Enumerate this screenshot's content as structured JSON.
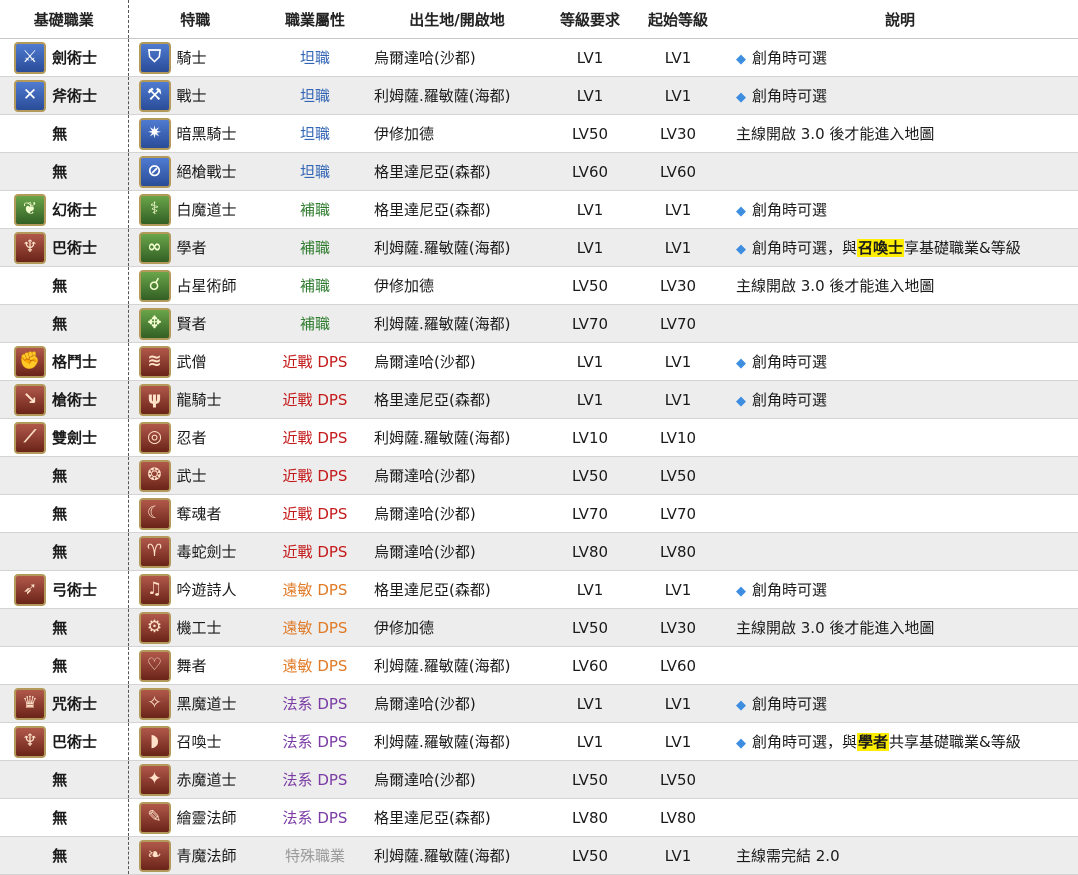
{
  "headers": {
    "base": "基礎職業",
    "job": "特職",
    "role": "職業屬性",
    "origin": "出生地/開啟地",
    "req": "等級要求",
    "start": "起始等級",
    "desc": "說明"
  },
  "colors": {
    "tank": "#3466b5",
    "healer": "#2f7d2f",
    "melee": "#c41a1a",
    "ranged": "#e07a26",
    "caster": "#7a3ba4",
    "special": "#9a9a9a",
    "highlight": "#ffee00"
  },
  "rows": [
    {
      "base": "劍術士",
      "base_icon": "sword-icon",
      "base_icon_glyph": "⚔",
      "base_color": "blue",
      "job": "騎士",
      "job_icon": "shield-icon",
      "job_icon_glyph": "⛉",
      "job_color": "blue",
      "role": "坦職",
      "role_class": "tank",
      "origin": "烏爾達哈(沙都)",
      "req": "LV1",
      "start": "LV1",
      "bullet": true,
      "desc": "創角時可選"
    },
    {
      "base": "斧術士",
      "base_icon": "axe-icon",
      "base_icon_glyph": "✕",
      "base_color": "blue",
      "job": "戰士",
      "job_icon": "warrior-icon",
      "job_icon_glyph": "⚒",
      "job_color": "blue",
      "role": "坦職",
      "role_class": "tank",
      "origin": "利姆薩.羅敏薩(海都)",
      "req": "LV1",
      "start": "LV1",
      "bullet": true,
      "desc": "創角時可選"
    },
    {
      "base": "無",
      "base_icon": "",
      "job": "暗黑騎士",
      "job_icon": "dark-knight-icon",
      "job_icon_glyph": "✷",
      "job_color": "blue",
      "role": "坦職",
      "role_class": "tank",
      "origin": "伊修加德",
      "req": "LV50",
      "start": "LV30",
      "bullet": false,
      "desc": "主線開啟 3.0 後才能進入地圖"
    },
    {
      "base": "無",
      "base_icon": "",
      "job": "絕槍戰士",
      "job_icon": "gunbreaker-icon",
      "job_icon_glyph": "⊘",
      "job_color": "blue",
      "role": "坦職",
      "role_class": "tank",
      "origin": "格里達尼亞(森都)",
      "req": "LV60",
      "start": "LV60",
      "bullet": false,
      "desc": ""
    },
    {
      "base": "幻術士",
      "base_icon": "conjurer-icon",
      "base_icon_glyph": "❦",
      "base_color": "green",
      "job": "白魔道士",
      "job_icon": "white-mage-icon",
      "job_icon_glyph": "⚕",
      "job_color": "green",
      "role": "補職",
      "role_class": "healer",
      "origin": "格里達尼亞(森都)",
      "req": "LV1",
      "start": "LV1",
      "bullet": true,
      "desc": "創角時可選"
    },
    {
      "base": "巴術士",
      "base_icon": "arcanist-icon",
      "base_icon_glyph": "♆",
      "base_color": "red",
      "job": "學者",
      "job_icon": "scholar-icon",
      "job_icon_glyph": "∞",
      "job_color": "green",
      "role": "補職",
      "role_class": "healer",
      "origin": "利姆薩.羅敏薩(海都)",
      "req": "LV1",
      "start": "LV1",
      "bullet": true,
      "desc": "創角時可選，與",
      "hl": "召喚士",
      "desc_after": "享基礎職業&等級"
    },
    {
      "base": "無",
      "base_icon": "",
      "job": "占星術師",
      "job_icon": "astrologian-icon",
      "job_icon_glyph": "☌",
      "job_color": "green",
      "role": "補職",
      "role_class": "healer",
      "origin": "伊修加德",
      "req": "LV50",
      "start": "LV30",
      "bullet": false,
      "desc": "主線開啟 3.0 後才能進入地圖"
    },
    {
      "base": "無",
      "base_icon": "",
      "job": "賢者",
      "job_icon": "sage-icon",
      "job_icon_glyph": "✥",
      "job_color": "green",
      "role": "補職",
      "role_class": "healer",
      "origin": "利姆薩.羅敏薩(海都)",
      "req": "LV70",
      "start": "LV70",
      "bullet": false,
      "desc": ""
    },
    {
      "base": "格鬥士",
      "base_icon": "pugilist-icon",
      "base_icon_glyph": "✊",
      "base_color": "red",
      "job": "武僧",
      "job_icon": "monk-icon",
      "job_icon_glyph": "≋",
      "job_color": "red",
      "role": "近戰 DPS",
      "role_class": "melee",
      "origin": "烏爾達哈(沙都)",
      "req": "LV1",
      "start": "LV1",
      "bullet": true,
      "desc": "創角時可選"
    },
    {
      "base": "槍術士",
      "base_icon": "lancer-icon",
      "base_icon_glyph": "↘",
      "base_color": "red",
      "job": "龍騎士",
      "job_icon": "dragoon-icon",
      "job_icon_glyph": "ψ",
      "job_color": "red",
      "role": "近戰 DPS",
      "role_class": "melee",
      "origin": "格里達尼亞(森都)",
      "req": "LV1",
      "start": "LV1",
      "bullet": true,
      "desc": "創角時可選"
    },
    {
      "base": "雙劍士",
      "base_icon": "rogue-icon",
      "base_icon_glyph": "⟋",
      "base_color": "red",
      "job": "忍者",
      "job_icon": "ninja-icon",
      "job_icon_glyph": "◎",
      "job_color": "red",
      "role": "近戰 DPS",
      "role_class": "melee",
      "origin": "利姆薩.羅敏薩(海都)",
      "req": "LV10",
      "start": "LV10",
      "bullet": false,
      "desc": ""
    },
    {
      "base": "無",
      "base_icon": "",
      "job": "武士",
      "job_icon": "samurai-icon",
      "job_icon_glyph": "❂",
      "job_color": "red",
      "role": "近戰 DPS",
      "role_class": "melee",
      "origin": "烏爾達哈(沙都)",
      "req": "LV50",
      "start": "LV50",
      "bullet": false,
      "desc": ""
    },
    {
      "base": "無",
      "base_icon": "",
      "job": "奪魂者",
      "job_icon": "reaper-icon",
      "job_icon_glyph": "☾",
      "job_color": "red",
      "role": "近戰 DPS",
      "role_class": "melee",
      "origin": "烏爾達哈(沙都)",
      "req": "LV70",
      "start": "LV70",
      "bullet": false,
      "desc": ""
    },
    {
      "base": "無",
      "base_icon": "",
      "job": "毒蛇劍士",
      "job_icon": "viper-icon",
      "job_icon_glyph": "♈",
      "job_color": "red",
      "role": "近戰 DPS",
      "role_class": "melee",
      "origin": "烏爾達哈(沙都)",
      "req": "LV80",
      "start": "LV80",
      "bullet": false,
      "desc": ""
    },
    {
      "base": "弓術士",
      "base_icon": "archer-icon",
      "base_icon_glyph": "➶",
      "base_color": "red",
      "job": "吟遊詩人",
      "job_icon": "bard-icon",
      "job_icon_glyph": "♫",
      "job_color": "red",
      "role": "遠敏 DPS",
      "role_class": "ranged",
      "origin": "格里達尼亞(森都)",
      "req": "LV1",
      "start": "LV1",
      "bullet": true,
      "desc": "創角時可選"
    },
    {
      "base": "無",
      "base_icon": "",
      "job": "機工士",
      "job_icon": "machinist-icon",
      "job_icon_glyph": "⚙",
      "job_color": "red",
      "role": "遠敏 DPS",
      "role_class": "ranged",
      "origin": "伊修加德",
      "req": "LV50",
      "start": "LV30",
      "bullet": false,
      "desc": "主線開啟 3.0 後才能進入地圖"
    },
    {
      "base": "無",
      "base_icon": "",
      "job": "舞者",
      "job_icon": "dancer-icon",
      "job_icon_glyph": "♡",
      "job_color": "red",
      "role": "遠敏 DPS",
      "role_class": "ranged",
      "origin": "利姆薩.羅敏薩(海都)",
      "req": "LV60",
      "start": "LV60",
      "bullet": false,
      "desc": ""
    },
    {
      "base": "咒術士",
      "base_icon": "thaumaturge-icon",
      "base_icon_glyph": "♛",
      "base_color": "red",
      "job": "黑魔道士",
      "job_icon": "black-mage-icon",
      "job_icon_glyph": "✧",
      "job_color": "red",
      "role": "法系 DPS",
      "role_class": "caster",
      "origin": "烏爾達哈(沙都)",
      "req": "LV1",
      "start": "LV1",
      "bullet": true,
      "desc": "創角時可選"
    },
    {
      "base": "巴術士",
      "base_icon": "arcanist-icon",
      "base_icon_glyph": "♆",
      "base_color": "red",
      "job": "召喚士",
      "job_icon": "summoner-icon",
      "job_icon_glyph": "◗",
      "job_color": "red",
      "role": "法系 DPS",
      "role_class": "caster",
      "origin": "利姆薩.羅敏薩(海都)",
      "req": "LV1",
      "start": "LV1",
      "bullet": true,
      "desc": "創角時可選，與",
      "hl": "學者",
      "desc_after": "共享基礎職業&等級"
    },
    {
      "base": "無",
      "base_icon": "",
      "job": "赤魔道士",
      "job_icon": "red-mage-icon",
      "job_icon_glyph": "✦",
      "job_color": "red",
      "role": "法系 DPS",
      "role_class": "caster",
      "origin": "烏爾達哈(沙都)",
      "req": "LV50",
      "start": "LV50",
      "bullet": false,
      "desc": ""
    },
    {
      "base": "無",
      "base_icon": "",
      "job": "繪靈法師",
      "job_icon": "pictomancer-icon",
      "job_icon_glyph": "✎",
      "job_color": "red",
      "role": "法系 DPS",
      "role_class": "caster",
      "origin": "格里達尼亞(森都)",
      "req": "LV80",
      "start": "LV80",
      "bullet": false,
      "desc": ""
    },
    {
      "base": "無",
      "base_icon": "",
      "job": "青魔法師",
      "job_icon": "blue-mage-icon",
      "job_icon_glyph": "❧",
      "job_color": "red",
      "role": "特殊職業",
      "role_class": "special",
      "origin": "利姆薩.羅敏薩(海都)",
      "req": "LV50",
      "start": "LV1",
      "bullet": false,
      "desc": "主線需完結 2.0"
    }
  ]
}
